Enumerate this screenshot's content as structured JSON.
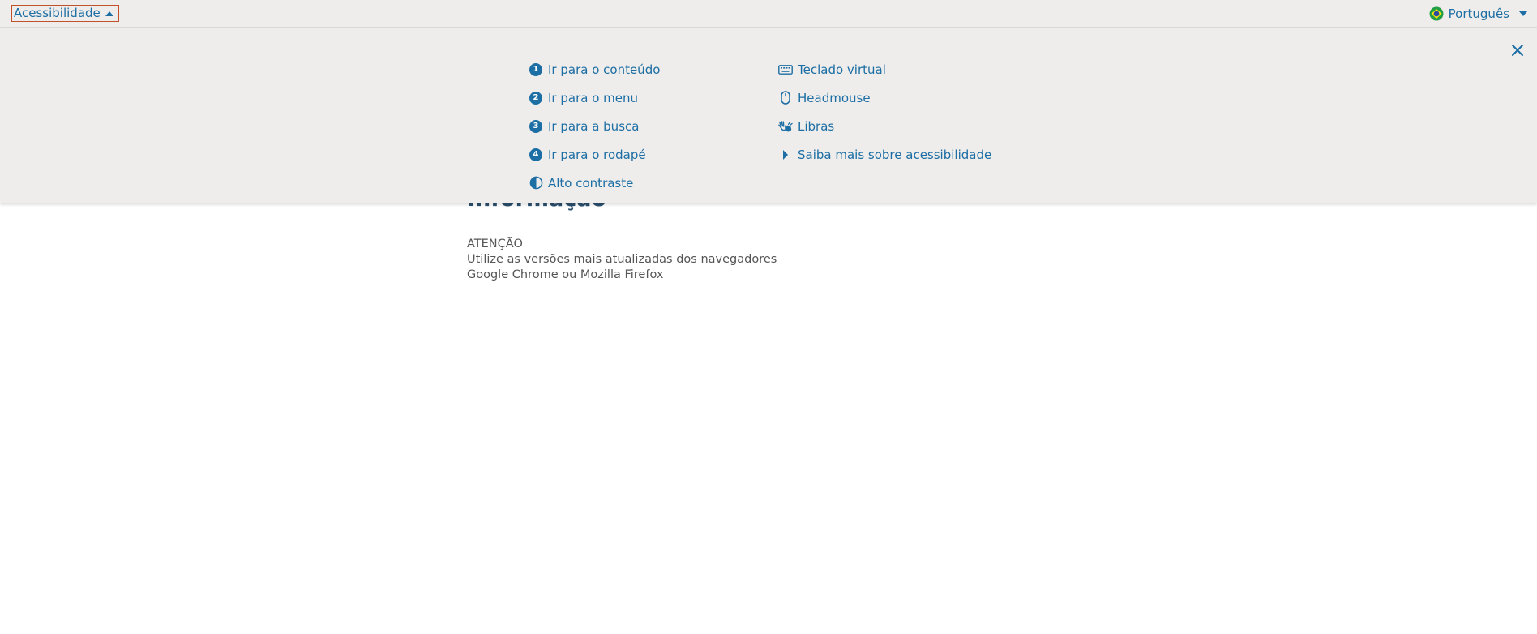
{
  "topbar": {
    "accessibility_label": "Acessibilidade",
    "language_label": "Português"
  },
  "panel": {
    "left_items": [
      {
        "number": "1",
        "label": "Ir para o conteúdo",
        "icon": "number-1-icon"
      },
      {
        "number": "2",
        "label": "Ir para o menu",
        "icon": "number-2-icon"
      },
      {
        "number": "3",
        "label": "Ir para a busca",
        "icon": "number-3-icon"
      },
      {
        "number": "4",
        "label": "Ir para o rodapé",
        "icon": "number-4-icon"
      },
      {
        "label": "Alto contraste",
        "icon": "contrast-icon"
      }
    ],
    "right_items": [
      {
        "label": "Teclado virtual",
        "icon": "keyboard-icon"
      },
      {
        "label": "Headmouse",
        "icon": "mouse-icon"
      },
      {
        "label": "Libras",
        "icon": "sign-language-icon"
      },
      {
        "label": "Saiba mais sobre acessibilidade",
        "icon": "caret-right-icon"
      }
    ]
  },
  "content": {
    "title": "Informação",
    "notice_line1": "ATENÇÃO",
    "notice_line2": "Utilize as versões mais atualizadas dos navegadores",
    "notice_line3": "Google Chrome ou Mozilla Firefox"
  },
  "colors": {
    "link": "#1c6ea4",
    "bar_bg": "#eeedeb",
    "focus_border": "#c0512a",
    "title": "#2a4e6c"
  }
}
